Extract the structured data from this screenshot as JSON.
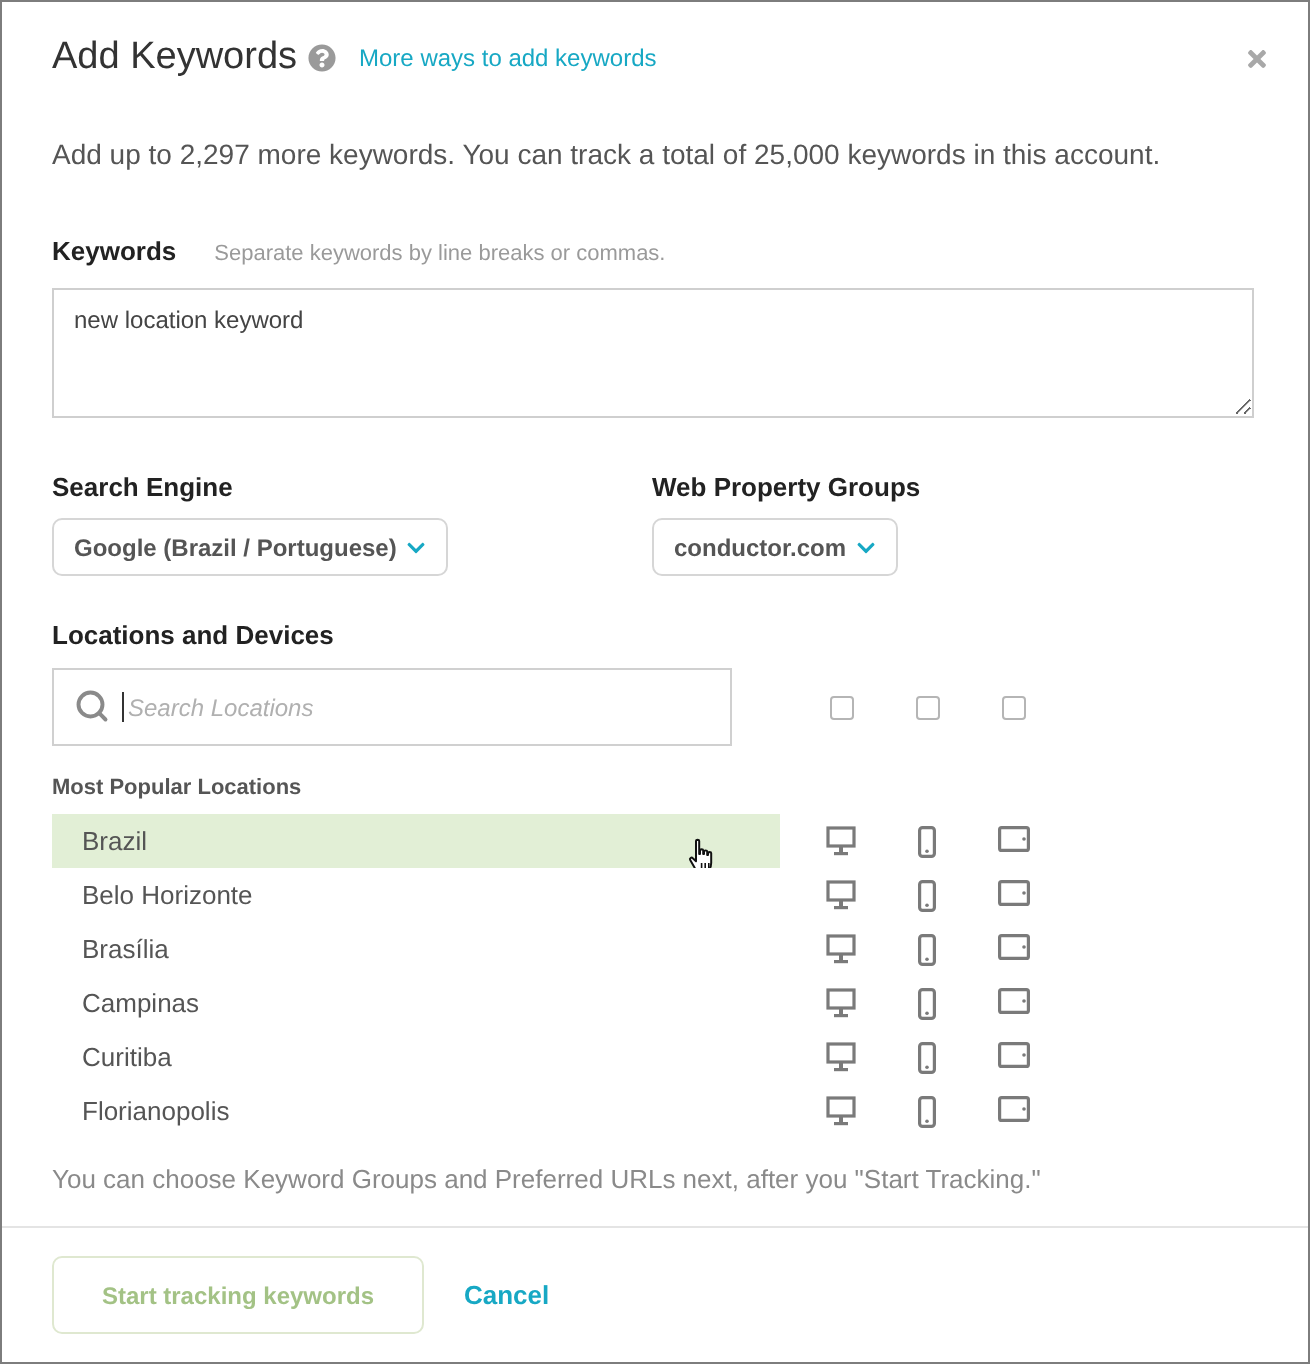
{
  "dialog": {
    "title": "Add Keywords",
    "help_link": "More ways to add keywords"
  },
  "intro": "Add up to 2,297 more keywords. You can track a total of 25,000 keywords in this account.",
  "keywords": {
    "label": "Keywords",
    "hint": "Separate keywords by line breaks or commas.",
    "value": "new location keyword"
  },
  "search_engine": {
    "label": "Search Engine",
    "value": "Google (Brazil / Portuguese)"
  },
  "web_property_groups": {
    "label": "Web Property Groups",
    "value": "conductor.com"
  },
  "locations": {
    "label": "Locations and Devices",
    "search": {
      "placeholder": "Search Locations"
    },
    "device_columns": [
      {
        "kind": "desktop",
        "checked": false
      },
      {
        "kind": "mobile",
        "checked": false
      },
      {
        "kind": "tablet",
        "checked": false
      }
    ],
    "list_heading": "Most Popular Locations",
    "items": [
      {
        "name": "Brazil",
        "selected": true
      },
      {
        "name": "Belo Horizonte",
        "selected": false
      },
      {
        "name": "Brasília",
        "selected": false
      },
      {
        "name": "Campinas",
        "selected": false
      },
      {
        "name": "Curitiba",
        "selected": false
      },
      {
        "name": "Florianopolis",
        "selected": false
      }
    ]
  },
  "note": "You can choose Keyword Groups and Preferred URLs next, after you \"Start Tracking.\"",
  "buttons": {
    "primary": {
      "label": "Start tracking keywords",
      "disabled": true
    },
    "cancel": "Cancel"
  }
}
